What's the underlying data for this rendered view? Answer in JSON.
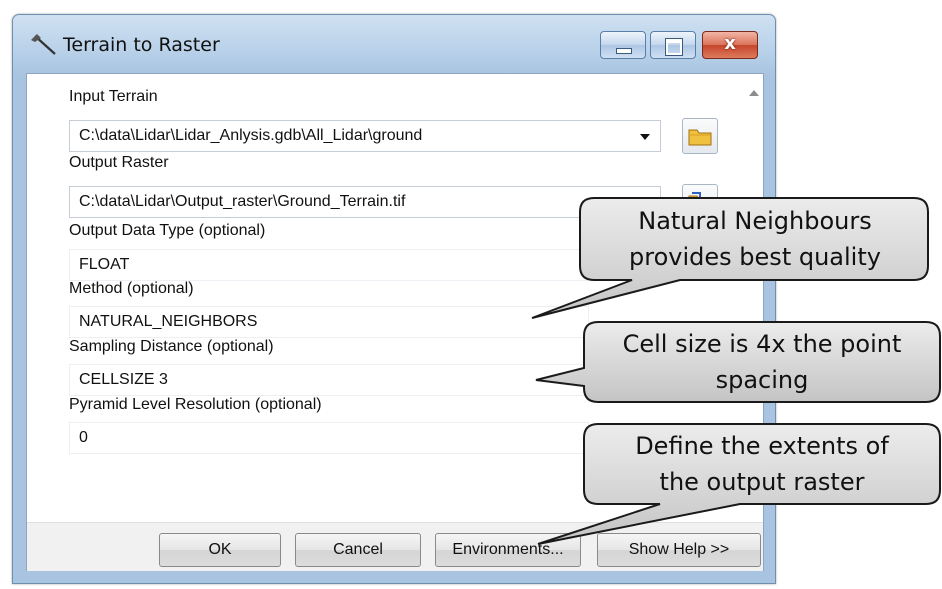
{
  "window": {
    "title": "Terrain to Raster",
    "icon": "terrain-tool-icon",
    "controls": [
      "minimize-icon",
      "maximize-icon",
      "close-icon"
    ],
    "close_glyph": "x"
  },
  "params": {
    "input_terrain": {
      "label": "Input Terrain",
      "value": "C:\\data\\Lidar\\Lidar_Anlysis.gdb\\All_Lidar\\ground"
    },
    "output_raster": {
      "label": "Output Raster",
      "value": "C:\\data\\Lidar\\Output_raster\\Ground_Terrain.tif"
    },
    "output_data_type": {
      "label": "Output Data Type (optional)",
      "value": "FLOAT"
    },
    "method": {
      "label": "Method (optional)",
      "value": "NATURAL_NEIGHBORS"
    },
    "sampling_distance": {
      "label": "Sampling Distance (optional)",
      "value": "CELLSIZE 3"
    },
    "pyramid_level": {
      "label": "Pyramid Level Resolution (optional)",
      "value": "0"
    }
  },
  "buttons": {
    "ok": "OK",
    "cancel": "Cancel",
    "environments": "Environments...",
    "show_help": "Show Help >>"
  },
  "callouts": {
    "c1": {
      "line1": "Natural Neighbours",
      "line2": "provides best quality"
    },
    "c2": {
      "line1": "Cell size is 4x the point",
      "line2": "spacing"
    },
    "c3": {
      "line1": "Define the extents of",
      "line2": "the output raster"
    }
  },
  "colors": {
    "title_bar": "#b6cfe8",
    "close_button": "#c5452a",
    "callout_fill": "#d6d6d6",
    "callout_border": "#1a1a1a"
  }
}
